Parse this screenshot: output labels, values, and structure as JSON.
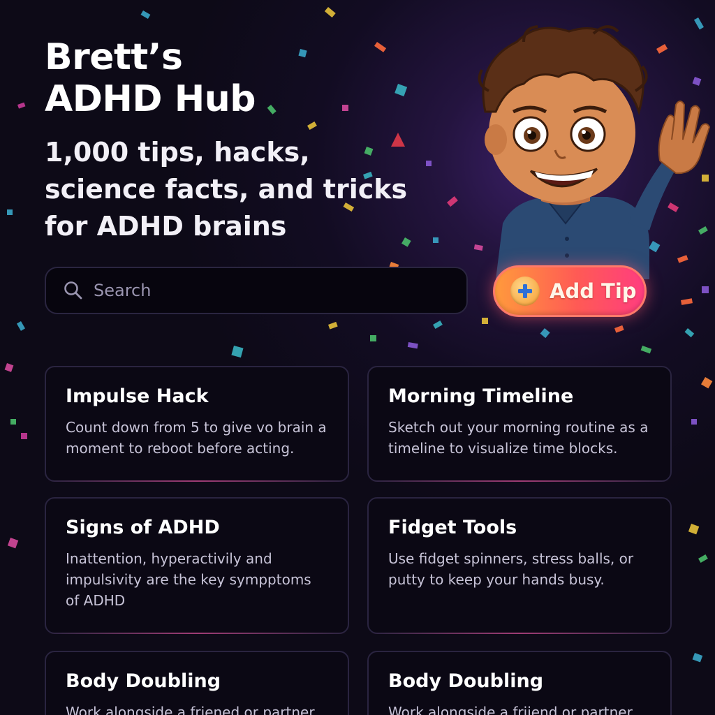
{
  "header": {
    "title": "Brett’s ADHD Hub",
    "subtitle": "1,000 tips, hacks, science facts, and tricks for ADHD brains"
  },
  "search": {
    "placeholder": "Search",
    "value": "",
    "icon": "search-icon"
  },
  "actions": {
    "add_tip_label": "Add Tip",
    "add_tip_icon": "plus-icon"
  },
  "tips": [
    {
      "title": "Impulse Hack",
      "body": "Count down from 5 to give vo brain a moment to reboot before acting."
    },
    {
      "title": "Morning Timeline",
      "body": "Sketch out your morning routine as a timeline to visualize time blocks."
    },
    {
      "title": "Signs of ADHD",
      "body": "Inattention, hyperactivily and impulsivity are the key sympptoms of ADHD"
    },
    {
      "title": "Fidget Tools",
      "body": "Use fidget spinners, stress balls, or putty to keep your hands busy."
    },
    {
      "title": "Body Doubling",
      "body": "Work alongside a friened or partner to"
    },
    {
      "title": "Body Doubling",
      "body": "Work alongside a friiend or partner to"
    }
  ],
  "colors": {
    "background": "#0d0a17",
    "accent_orange": "#ff9a3c",
    "accent_pink": "#ff3d7f",
    "card_border": "#2a2440"
  }
}
